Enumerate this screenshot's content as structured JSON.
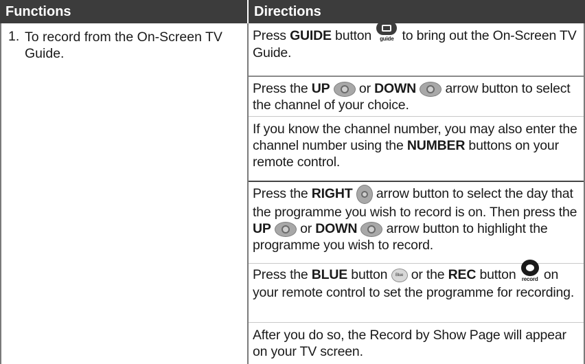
{
  "header": {
    "functions": "Functions",
    "directions": "Directions"
  },
  "function_item": {
    "number": "1.",
    "text": "To record from the On-Screen TV Guide."
  },
  "icons": {
    "guide_label": "guide",
    "blue_label": "Blue",
    "rec_label": "record"
  },
  "directions": {
    "r1": {
      "a": "Press ",
      "b": "GUIDE",
      "c": " button ",
      "d": " to bring out the On-Screen TV Guide."
    },
    "r2": {
      "a": "Press the ",
      "b": "UP",
      "c": " or ",
      "d": "DOWN",
      "e": " arrow button to select the channel of your choice."
    },
    "r3": {
      "a": "If you know the channel number, you may also enter the channel number using the ",
      "b": "NUMBER",
      "c": " buttons on your remote control."
    },
    "r4": {
      "a": "Press the ",
      "b": "RIGHT",
      "c": " arrow button to select the day that the programme you wish to record is on. Then press the ",
      "d": "UP",
      "e": " or ",
      "f": "DOWN",
      "g": " arrow button to highlight the programme you wish to record."
    },
    "r5": {
      "a": "Press the ",
      "b": "BLUE",
      "c": " button ",
      "d": " or the ",
      "e": "REC",
      "f": " button ",
      "g": " on your remote control to set the programme for recording."
    },
    "r6": {
      "a": "After you do so, the Record by Show Page will appear on your TV screen."
    }
  }
}
